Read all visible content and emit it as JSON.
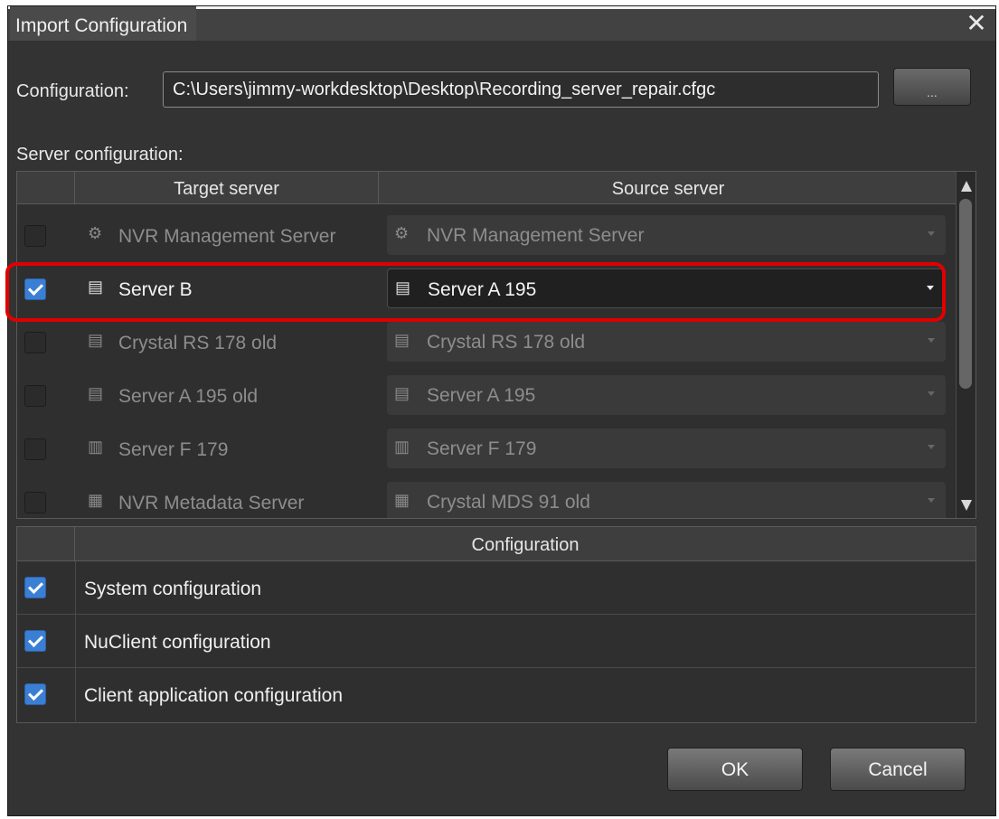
{
  "window": {
    "title": "Import Configuration",
    "close_glyph": "✕"
  },
  "config_path": {
    "label": "Configuration:",
    "value": "C:\\Users\\jimmy-workdesktop\\Desktop\\Recording_server_repair.cfgc",
    "browse_label": "..."
  },
  "server_section": {
    "label": "Server configuration:"
  },
  "server_table": {
    "headers": {
      "target": "Target server",
      "source": "Source server"
    },
    "rows": [
      {
        "checked": false,
        "target_icon": "management-server-icon",
        "target": "NVR Management Server",
        "source_icon": "management-server-icon",
        "source": "NVR Management Server"
      },
      {
        "checked": true,
        "target_icon": "recording-server-icon",
        "target": "Server B",
        "source_icon": "recording-server-icon",
        "source": "Server A 195"
      },
      {
        "checked": false,
        "target_icon": "recording-server-icon",
        "target": "Crystal RS 178 old",
        "source_icon": "recording-server-icon",
        "source": "Crystal RS 178 old"
      },
      {
        "checked": false,
        "target_icon": "recording-server-icon",
        "target": "Server A 195 old",
        "source_icon": "recording-server-icon",
        "source": "Server A 195"
      },
      {
        "checked": false,
        "target_icon": "cluster-server-icon",
        "target": "Server F 179",
        "source_icon": "cluster-server-icon",
        "source": "Server F 179"
      },
      {
        "checked": false,
        "target_icon": "metadata-server-icon",
        "target": "NVR Metadata Server",
        "source_icon": "metadata-server-icon",
        "source": "Crystal MDS 91 old"
      }
    ]
  },
  "config_table": {
    "header": "Configuration",
    "rows": [
      {
        "checked": true,
        "label": "System configuration"
      },
      {
        "checked": true,
        "label": "NuClient configuration"
      },
      {
        "checked": true,
        "label": "Client application configuration"
      }
    ]
  },
  "buttons": {
    "ok": "OK",
    "cancel": "Cancel"
  },
  "colors": {
    "background": "#333333",
    "highlight": "#e10000",
    "checkbox_checked": "#3b7fd4"
  }
}
